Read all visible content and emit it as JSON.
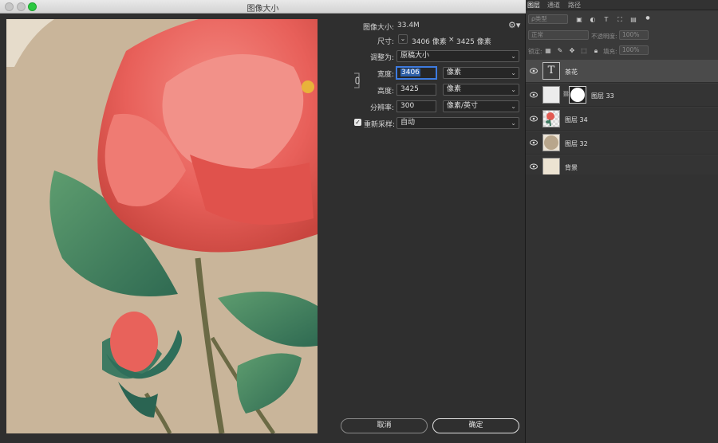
{
  "window": {
    "title": "图像大小"
  },
  "settings": {
    "image_size_label": "图像大小:",
    "image_size_value": "33.4M",
    "dimensions_label": "尺寸:",
    "dimensions_width": "3406 像素",
    "dimensions_sep": "×",
    "dimensions_height": "3425 像素",
    "fit_to_label": "调整为:",
    "fit_to_value": "原稿大小",
    "width_label": "宽度:",
    "width_value": "3406",
    "width_unit": "像素",
    "height_label": "高度:",
    "height_value": "3425",
    "height_unit": "像素",
    "resolution_label": "分辨率:",
    "resolution_value": "300",
    "resolution_unit": "像素/英寸",
    "resample_label": "重新采样:",
    "resample_checked": true,
    "resample_value": "自动"
  },
  "buttons": {
    "cancel": "取消",
    "ok": "确定"
  },
  "panel": {
    "tabs": [
      "图层",
      "通道",
      "路径"
    ],
    "filter_kind": "ρ类型",
    "blend_mode": "正常",
    "opacity_label": "不透明度:",
    "opacity_value": "100%",
    "lock_label": "锁定:",
    "fill_label": "填充:",
    "fill_value": "100%",
    "layers": [
      {
        "name": "茶花",
        "type": "text",
        "selected": true
      },
      {
        "name": "图层 33",
        "type": "masked"
      },
      {
        "name": "图层 34",
        "type": "image"
      },
      {
        "name": "图层 32",
        "type": "circle"
      },
      {
        "name": "背景",
        "type": "background"
      }
    ]
  },
  "colors": {
    "accent": "#3d7be0",
    "canvas_bg": "#c9b59a",
    "petal": "#e8605a",
    "leaf": "#3f7a5f"
  }
}
